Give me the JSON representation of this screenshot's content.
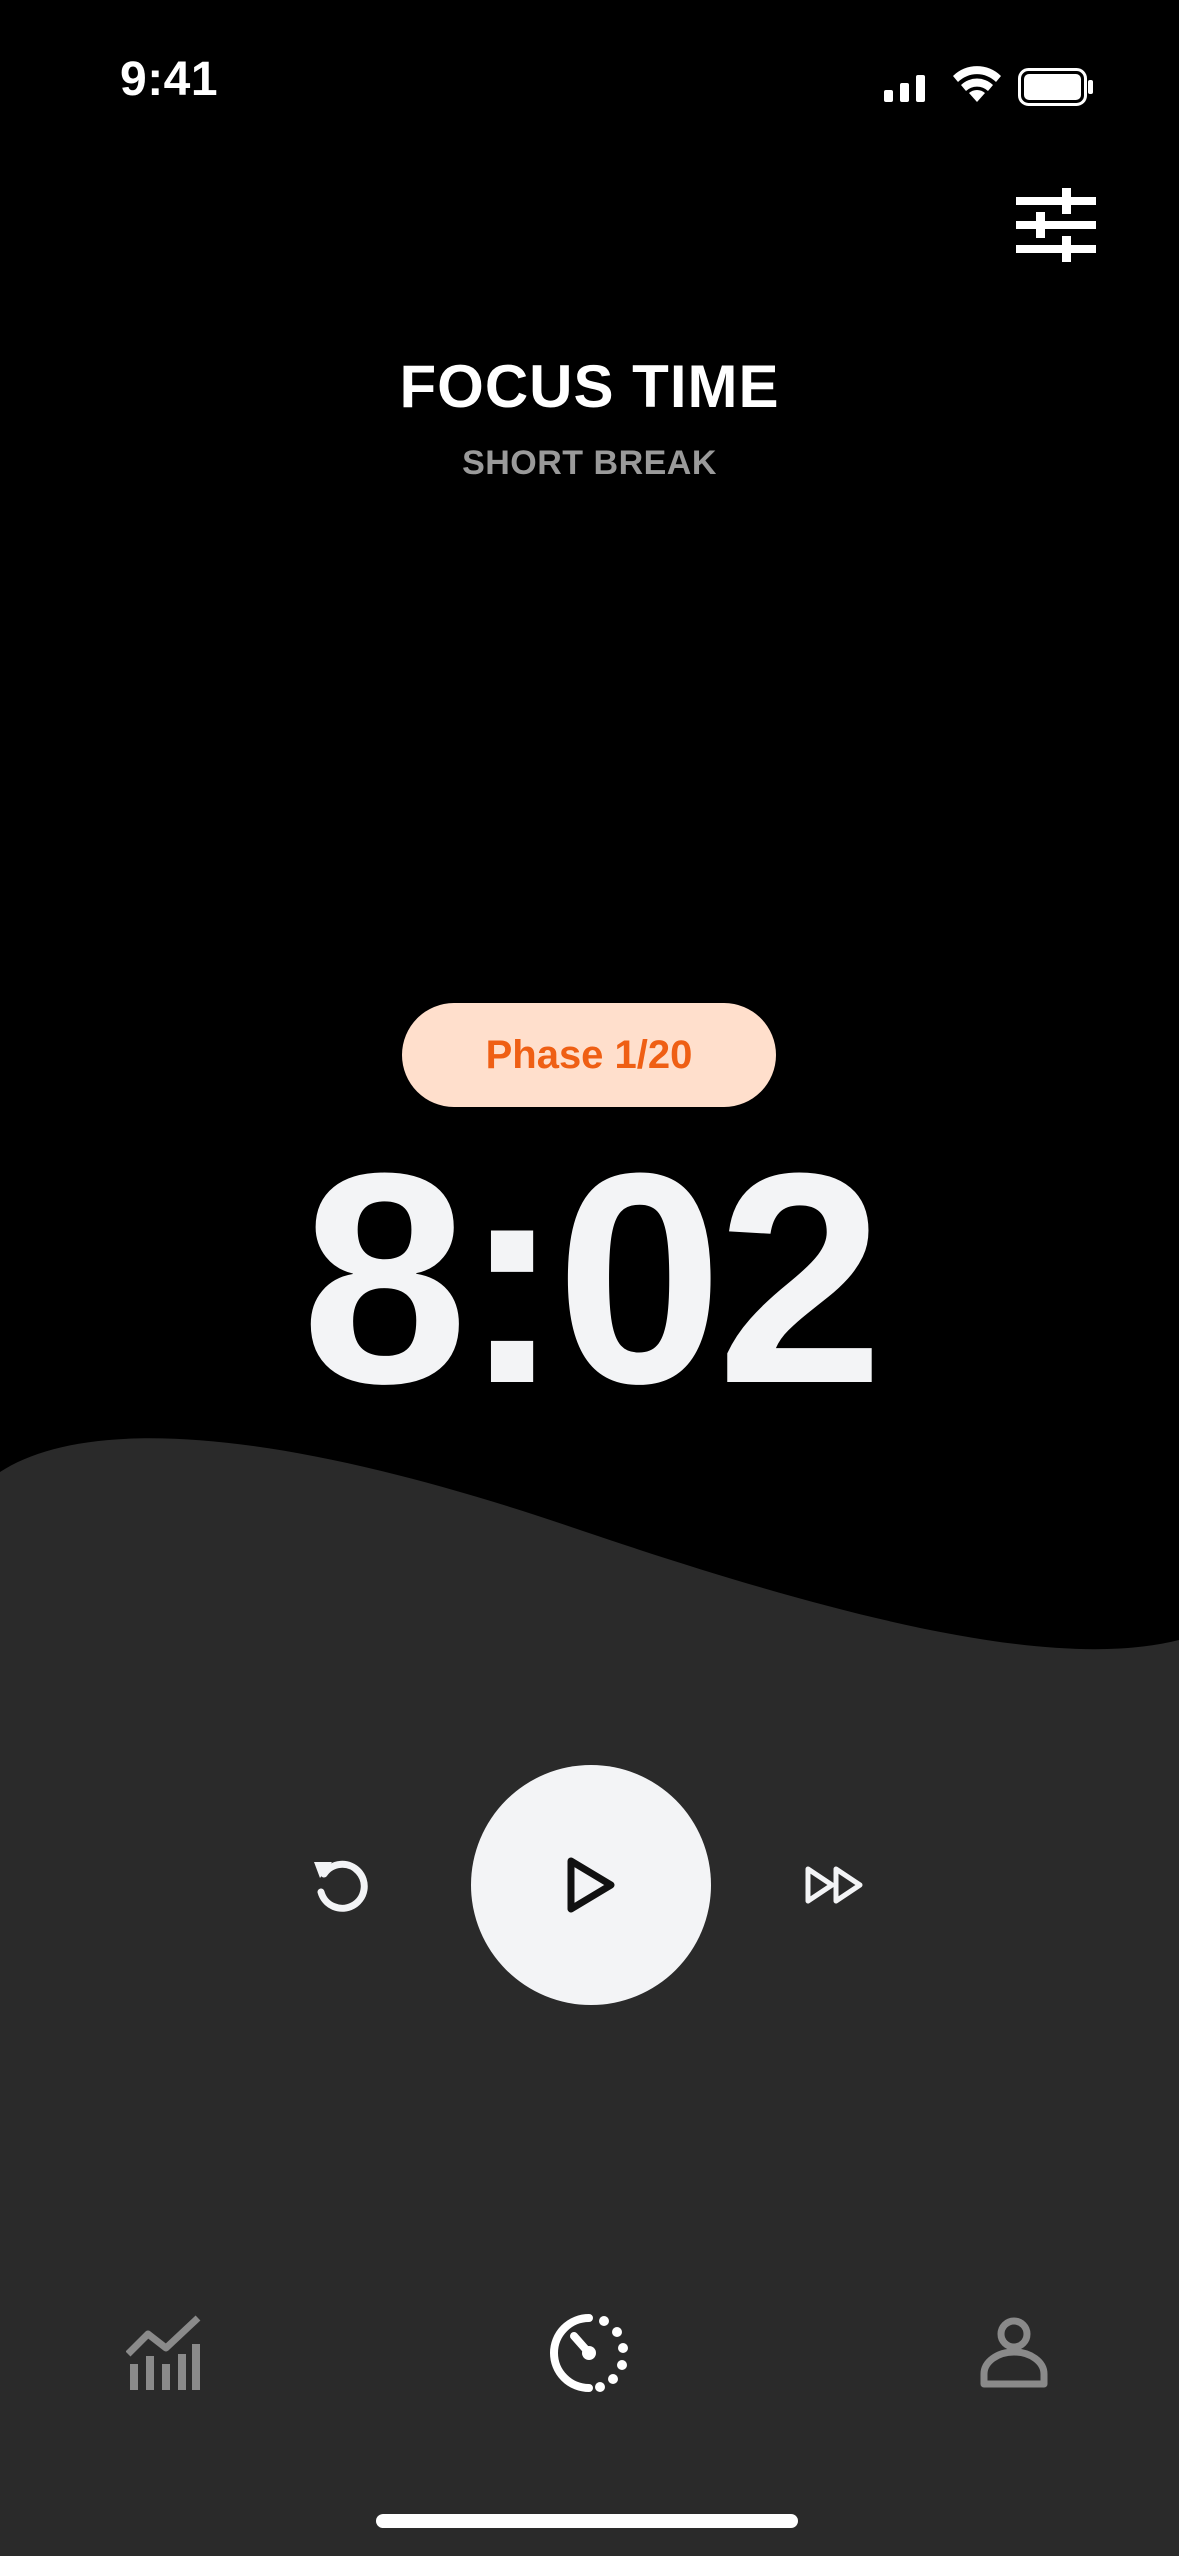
{
  "status_bar": {
    "time": "9:41"
  },
  "header": {
    "settings_icon": "sliders-icon"
  },
  "session": {
    "title": "FOCUS TIME",
    "subtitle": "SHORT BREAK",
    "phase_label": "Phase 1/20",
    "timer": "8:02"
  },
  "controls": {
    "reset_icon": "reset-icon",
    "play_icon": "play-icon",
    "skip_icon": "fast-forward-icon"
  },
  "tab_bar": {
    "items": [
      {
        "name": "stats",
        "icon": "chart-icon",
        "active": false
      },
      {
        "name": "timer",
        "icon": "timer-icon",
        "active": true
      },
      {
        "name": "profile",
        "icon": "profile-icon",
        "active": false
      }
    ]
  },
  "colors": {
    "background": "#000000",
    "panel": "#2a2a2a",
    "accent": "#ef5f14",
    "pill_background": "#ffdfcc",
    "text_primary": "#f3f4f6",
    "text_secondary": "#9a9a9a",
    "inactive_icon": "#8a8a8a"
  }
}
